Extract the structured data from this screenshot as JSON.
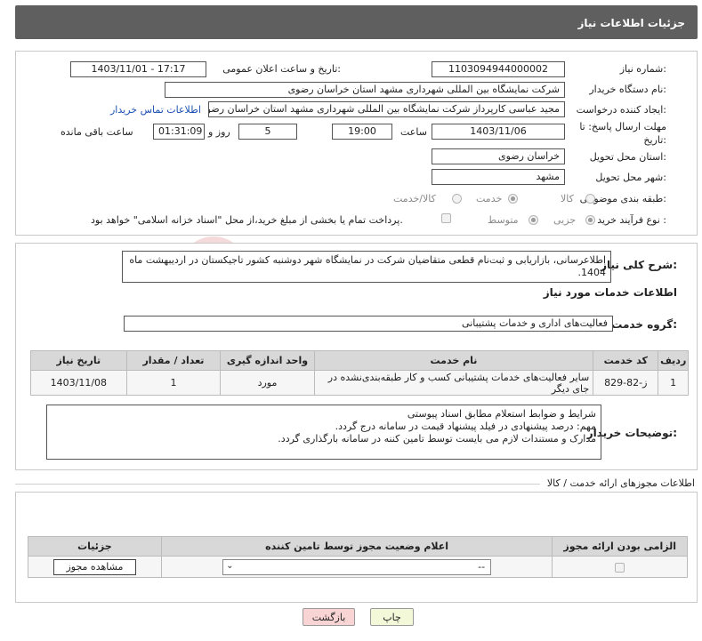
{
  "header": {
    "title": "جزئیات اطلاعات نیاز"
  },
  "form": {
    "need_number_label": "شماره نیاز:",
    "need_number": "1103094944000002",
    "announce_label": "تاریخ و ساعت اعلان عمومی:",
    "announce_value": "1403/11/01 - 17:17",
    "buyer_org_label": "نام دستگاه خریدار:",
    "buyer_org": "شرکت نمایشگاه بین المللی شهرداری مشهد استان خراسان رضوی",
    "requester_label": "ایجاد کننده درخواست:",
    "requester": "مجید عباسی کارپرداز شرکت نمایشگاه بین المللی شهرداری مشهد استان خراسان رضوی",
    "buyer_contact_link": "اطلاعات تماس خریدار",
    "deadline_label": "مهلت ارسال پاسخ: تا تاریخ:",
    "deadline_date": "1403/11/06",
    "time_label": "ساعت",
    "deadline_time": "19:00",
    "days_value": "5",
    "days_label": "روز و",
    "remaining_time": "01:31:09",
    "remaining_label": "ساعت باقی مانده",
    "province_label": "استان محل تحویل:",
    "province": "خراسان رضوی",
    "city_label": "شهر محل تحویل:",
    "city": "مشهد",
    "category_label": "طبقه بندی موضوعی:",
    "category_options": [
      "کالا",
      "خدمت",
      "کالا/خدمت"
    ],
    "category_selected": "خدمت",
    "process_label": "نوع فرآیند خرید :",
    "process_options": [
      "جزیی",
      "متوسط"
    ],
    "process_selected": "جزیی",
    "payment_note": "پرداخت تمام یا بخشی از مبلغ خرید،از محل \"اسناد خزانه اسلامی\" خواهد بود."
  },
  "summary": {
    "label": "شرح کلی نیاز:",
    "text": "اطلاعرسانی، بازاریابی و ثبت‌نام قطعی متقاضیان شرکت در نمایشگاه شهر دوشنبه کشور تاجیکستان در اردیبهشت ماه 1404."
  },
  "services": {
    "section_title": "اطلاعات خدمات مورد نیاز",
    "group_label": "گروه خدمت:",
    "group_value": "فعالیت‌های اداری و خدمات پشتیبانی",
    "columns": [
      "ردیف",
      "کد خدمت",
      "نام خدمت",
      "واحد اندازه گیری",
      "تعداد / مقدار",
      "تاریخ نیاز"
    ],
    "rows": [
      {
        "idx": "1",
        "code": "ز-82-829",
        "name": "سایر فعالیت‌های خدمات پشتیبانی کسب و کار طبقه‌بندی‌نشده در جای دیگر",
        "unit": "مورد",
        "qty": "1",
        "date": "1403/11/08"
      }
    ]
  },
  "buyer_notes": {
    "label": "توضیحات خریدار:",
    "line1": "شرایط و ضوابط استعلام مطابق اسناد پیوستی",
    "line2": "مهم: درصد پیشنهادی در فیلد پیشنهاد قیمت در سامانه درج گردد.",
    "line3": "مدارک و مستندات لازم می بایست توسط تامین کننه در سامانه بارگذاری گردد."
  },
  "permits": {
    "section_title": "اطلاعات مجوزهای ارائه خدمت / کالا",
    "columns": [
      "الزامی بودن ارائه مجوز",
      "اعلام وضعیت مجوز توسط تامین کننده",
      "جزئیات"
    ],
    "select_value": "--",
    "view_button": "مشاهده مجوز"
  },
  "footer": {
    "print_button": "چاپ",
    "back_button": "بازگشت"
  },
  "watermark": {
    "text": "AriaTender.net"
  },
  "colors": {
    "header_bg": "#5f5f5f",
    "link": "#1a4fb3",
    "print_bg": "#f3f8d8",
    "back_bg": "#f9d4d4"
  }
}
